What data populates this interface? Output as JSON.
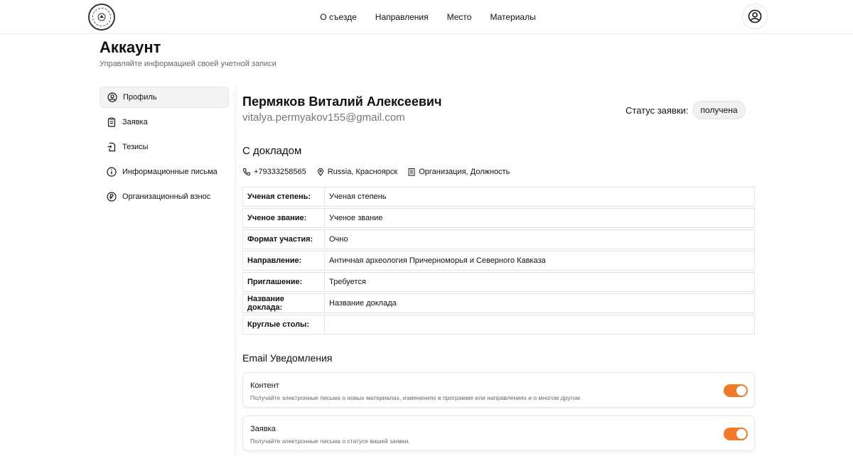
{
  "header": {
    "nav": [
      "О съезде",
      "Направления",
      "Место",
      "Материалы"
    ]
  },
  "page": {
    "title": "Аккаунт",
    "subtitle": "Управляйте информацией своей учетной записи"
  },
  "sidebar": {
    "items": [
      {
        "label": "Профиль",
        "icon": "user-circle-icon"
      },
      {
        "label": "Заявка",
        "icon": "clipboard-icon"
      },
      {
        "label": "Тезисы",
        "icon": "document-import-icon"
      },
      {
        "label": "Информационные письма",
        "icon": "info-icon"
      },
      {
        "label": "Организационный взнос",
        "icon": "currency-icon"
      }
    ]
  },
  "profile": {
    "name": "Пермяков Виталий Алексеевич",
    "email": "vitalya.permyakov155@gmail.com",
    "status_label": "Статус заявки:",
    "status_value": "получена"
  },
  "report": {
    "section_title": "С докладом",
    "phone": "+79333258565",
    "location": "Russia, Красноярск",
    "organization": "Организация, Должность",
    "rows": [
      {
        "key": "Ученая степень:",
        "value": "Ученая степень"
      },
      {
        "key": "Ученое звание:",
        "value": "Ученое звание"
      },
      {
        "key": "Формат участия:",
        "value": "Очно"
      },
      {
        "key": "Направление:",
        "value": "Античная археология Причерноморья и Северного Кавказа"
      },
      {
        "key": "Приглашение:",
        "value": "Требуется"
      },
      {
        "key": "Название доклада:",
        "value": "Название доклада"
      },
      {
        "key": "Круглые столы:",
        "value": ""
      }
    ]
  },
  "notifications": {
    "title": "Email Уведомления",
    "items": [
      {
        "title": "Контент",
        "desc": "Получайте электронные письма о новых материалах, изменениях в программе или направлениях и о многом другом.",
        "enabled": true
      },
      {
        "title": "Заявка",
        "desc": "Получайте электронные письма о статусе вашей заявки.",
        "enabled": true
      }
    ]
  },
  "colors": {
    "accent": "#f07a2a"
  }
}
